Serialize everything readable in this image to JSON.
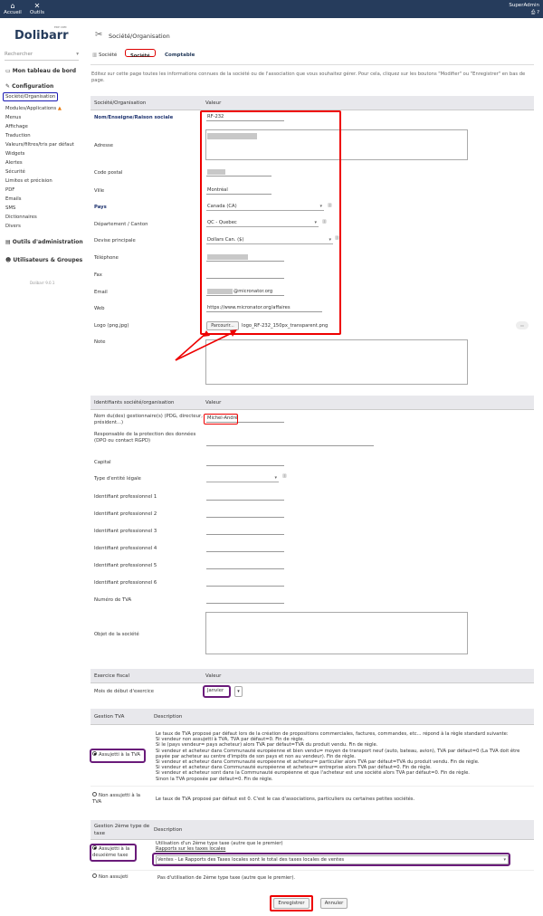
{
  "topbar": {
    "home_label": "Accueil",
    "tools_label": "Outils",
    "user": "SuperAdmin"
  },
  "sidebar": {
    "logo": "Dolibarr",
    "logo_sub": "ERP CRM",
    "search_placeholder": "Rechercher",
    "dashboard": "Mon tableau de bord",
    "config": "Configuration",
    "items": [
      "Société/Organisation",
      "Modules/Applications",
      "Menus",
      "Affichage",
      "Traduction",
      "Valeurs/filtres/tris par défaut",
      "Widgets",
      "Alertes",
      "Sécurité",
      "Limites et précision",
      "PDF",
      "Emails",
      "SMS",
      "Dictionnaires",
      "Divers"
    ],
    "admin_tools": "Outils d'administration",
    "users_groups": "Utilisateurs & Groupes",
    "version": "Dolibarr 9.0.1"
  },
  "page": {
    "title": "Société/Organisation",
    "tabs": [
      "Société",
      "Société",
      "Comptable"
    ],
    "intro": "Editez sur cette page toutes les informations connues de la société ou de l'association que vous souhaitez gérer. Pour cela, cliquez sur les boutons \"Modifier\" ou \"Enregistrer\" en bas de page."
  },
  "company": {
    "header_label": "Société/Organisation",
    "header_value": "Valeur",
    "name_label": "Nom/Enseigne/Raison sociale",
    "name_value": "RF-232",
    "address_label": "Adresse",
    "zip_label": "Code postal",
    "town_label": "Ville",
    "town_value": "Montréal",
    "country_label": "Pays",
    "country_value": "Canada (CA)",
    "state_label": "Département / Canton",
    "state_value": "QC - Quebec",
    "currency_label": "Devise principale",
    "currency_value": "Dollars Can. ($)",
    "phone_label": "Téléphone",
    "fax_label": "Fax",
    "email_label": "Email",
    "email_value": "@micronator.org",
    "web_label": "Web",
    "web_value": "https://www.micronator.org/affaires",
    "logo_label": "Logo (png,jpg)",
    "browse_button": "Parcourir...",
    "logo_file": "logo_RF-232_150px_transparent.png",
    "note_label": "Note"
  },
  "ids": {
    "header_label": "Identifiants société/organisation",
    "header_value": "Valeur",
    "manager_label": "Nom du(des) gestionnaire(s) (PDG, directeur, président...)",
    "manager_value": "Michel-André",
    "gdpr_label": "Responsable de la protection des données (DPO ou contact RGPD)",
    "capital_label": "Capital",
    "legal_label": "Type d'entité légale",
    "prof_labels": [
      "Identifiant professionnel 1",
      "Identifiant professionnel 2",
      "Identifiant professionnel 3",
      "Identifiant professionnel 4",
      "Identifiant professionnel 5",
      "Identifiant professionnel 6"
    ],
    "vat_label": "Numéro de TVA",
    "object_label": "Objet de la société"
  },
  "fiscal": {
    "header_label": "Exercice fiscal",
    "header_value": "Valeur",
    "month_label": "Mois de début d'exercice",
    "month_value": "Janvier"
  },
  "vat": {
    "header_label": "Gestion TVA",
    "header_desc": "Description",
    "subject_label": "Assujetti à la TVA",
    "subject_desc": "Le taux de TVA proposé par défaut lors de la création de propositions commerciales, factures, commandes, etc... répond à la règle standard suivante:\nSi vendeur non assujetti à TVA, TVA par défaut=0. Fin de règle.\nSi le (pays vendeur= pays acheteur) alors TVA par défaut=TVA du produit vendu. Fin de règle.\nSi vendeur et acheteur dans Communauté européenne et bien vendu= moyen de transport neuf (auto, bateau, avion), TVA par défaut=0 (La TVA doit être payée par acheteur au centre d'impôts de son pays et non au vendeur). Fin de règle.\nSi vendeur et acheteur dans Communauté européenne et acheteur= particulier alors TVA par défaut=TVA du produit vendu. Fin de règle.\nSi vendeur et acheteur dans Communauté européenne et acheteur= entreprise alors TVA par défaut=0. Fin de règle.\nSi vendeur et acheteur sont dans la Communauté européenne et que l'acheteur est une société alors TVA par défaut=0. Fin de règle.\nSinon la TVA proposée par défaut=0. Fin de règle.",
    "not_subject_label": "Non assujetti à la TVA",
    "not_subject_desc": "Le taux de TVA proposé par défaut est 0. C'est le cas d'associations, particuliers ou certaines petites sociétés."
  },
  "tax2": {
    "header_label": "Gestion 2ème type de taxe",
    "header_desc": "Description",
    "subject_label": "Assujetti à la deuxième taxe",
    "subject_desc1": "Utilisation d'un 2ème type taxe (autre que le premier)",
    "subject_desc2": "Rapports sur les taxes locales",
    "subject_select": "Ventes - Le Rapports des Taxes locales sont le total des taxes locales de ventes",
    "not_subject_label": "Non assujeti",
    "not_subject_desc": "Pas d'utilisation de 2ème type taxe (autre que le premier)."
  },
  "actions": {
    "save": "Enregistrer",
    "cancel": "Annuler"
  }
}
